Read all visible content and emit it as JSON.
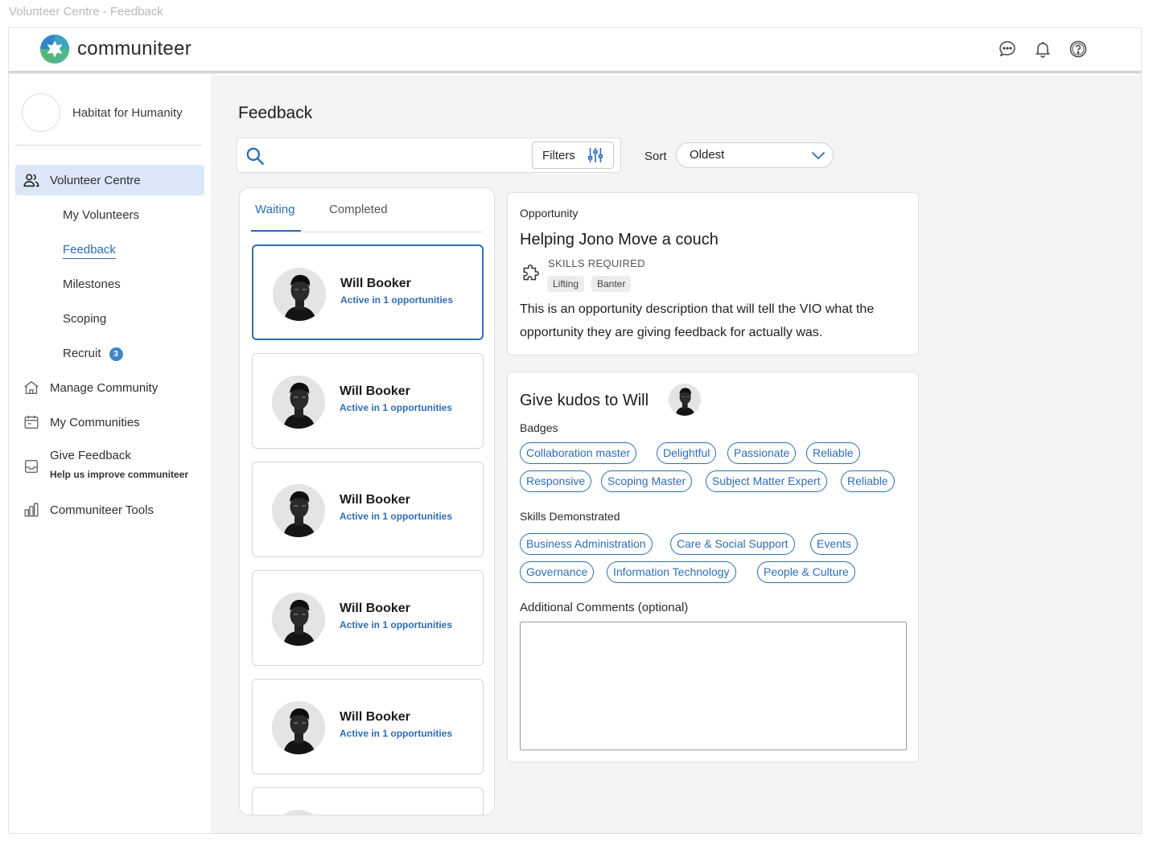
{
  "window": {
    "caption": "Volunteer Centre - Feedback"
  },
  "header": {
    "brand": "communiteer",
    "icons": [
      "chat-icon",
      "bell-icon",
      "help-icon"
    ]
  },
  "sidebar": {
    "org_name": "Habitat for Humanity",
    "volunteer_centre": "Volunteer Centre",
    "sub_items": {
      "my_volunteers": "My Volunteers",
      "feedback": "Feedback",
      "milestones": "Milestones",
      "scoping": "Scoping",
      "recruit": "Recruit",
      "recruit_count": "3"
    },
    "manage_community": "Manage Community",
    "my_communities": "My Communities",
    "give_feedback": "Give Feedback",
    "give_feedback_sub": "Help us improve communiteer",
    "communiteer_tools": "Communiteer Tools"
  },
  "main": {
    "title": "Feedback",
    "filters_label": "Filters",
    "sort_label": "Sort",
    "sort_value": "Oldest"
  },
  "tabs": {
    "waiting": "Waiting",
    "completed": "Completed"
  },
  "volunteers": [
    {
      "name": "Will Booker",
      "status": "Active in 1 opportunities"
    },
    {
      "name": "Will Booker",
      "status": "Active in 1 opportunities"
    },
    {
      "name": "Will Booker",
      "status": "Active in 1 opportunities"
    },
    {
      "name": "Will Booker",
      "status": "Active in 1 opportunities"
    },
    {
      "name": "Will Booker",
      "status": "Active in 1 opportunities"
    }
  ],
  "opportunity": {
    "label": "Opportunity",
    "title": "Helping Jono Move a couch",
    "skills_required_label": "SKILLS REQUIRED",
    "skills": [
      "Lifting",
      "Banter"
    ],
    "description": "This is an opportunity description that will tell the VIO what the opportunity they are giving feedback for actually was."
  },
  "kudos": {
    "title": "Give kudos to Will",
    "badges_label": "Badges",
    "badges": [
      "Collaboration master",
      "Delightful",
      "Passionate",
      "Reliable",
      "Responsive",
      "Scoping Master",
      "Subject Matter Expert",
      "Reliable"
    ],
    "skills_label": "Skills Demonstrated",
    "skills": [
      "Business Administration",
      "Care & Social Support",
      "Events",
      "Governance",
      "Information Technology",
      "People & Culture"
    ],
    "comments_label": "Additional Comments (optional)",
    "comments_value": ""
  },
  "colors": {
    "accent": "#2f6db5",
    "active_nav_bg": "#dbe7f7",
    "main_bg": "#f3f4f6",
    "badge_bg": "#3d86c6"
  }
}
